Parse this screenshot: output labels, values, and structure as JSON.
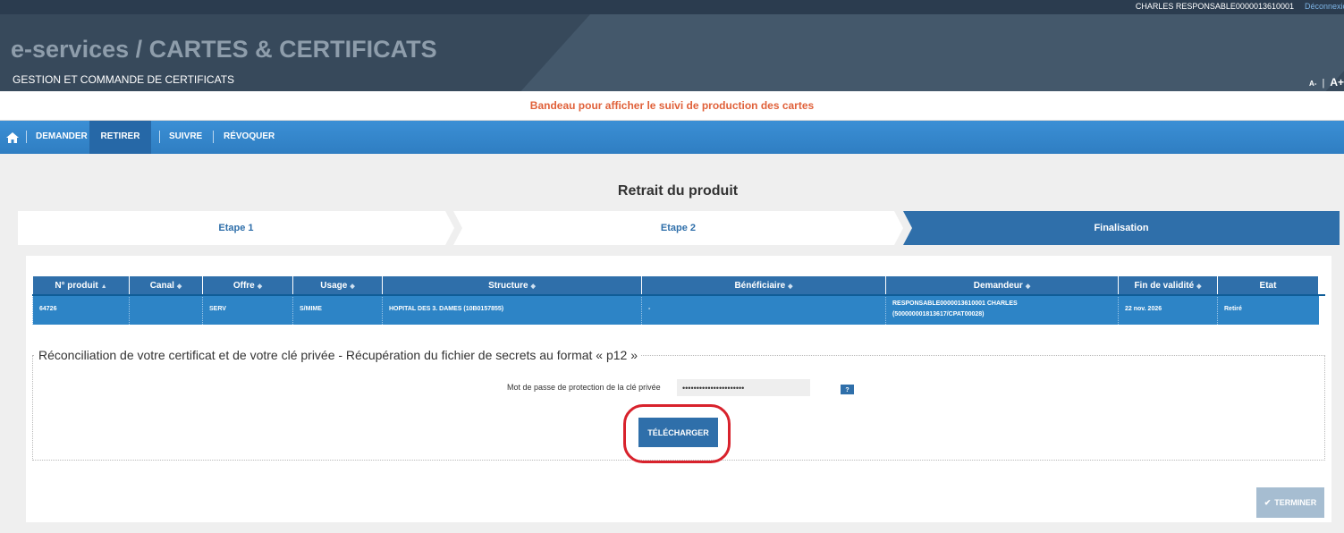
{
  "header": {
    "user_name": "CHARLES RESPONSABLE0000013610001",
    "logout_label": "Déconnexion",
    "app_title": "e-services / CARTES & CERTIFICATS",
    "app_subtitle": "GESTION ET COMMANDE DE CERTIFICATS",
    "font_decrease": "A-",
    "font_separator": "|",
    "font_increase": "A+"
  },
  "notice": "Bandeau pour afficher le suivi de production des cartes",
  "nav": {
    "home_icon": "home-icon",
    "items": [
      {
        "label": "DEMANDER",
        "active": false
      },
      {
        "label": "RETIRER",
        "active": true
      },
      {
        "label": "SUIVRE",
        "active": false
      },
      {
        "label": "RÉVOQUER",
        "active": false
      }
    ]
  },
  "page_title": "Retrait du produit",
  "steps": [
    {
      "label": "Etape 1",
      "active": false
    },
    {
      "label": "Etape 2",
      "active": false
    },
    {
      "label": "Finalisation",
      "active": true
    }
  ],
  "table": {
    "columns": [
      {
        "label": "N° produit",
        "sort": "▲"
      },
      {
        "label": "Canal",
        "sort": "◆"
      },
      {
        "label": "Offre",
        "sort": "◆"
      },
      {
        "label": "Usage",
        "sort": "◆"
      },
      {
        "label": "Structure",
        "sort": "◆"
      },
      {
        "label": "Bénéficiaire",
        "sort": "◆"
      },
      {
        "label": "Demandeur",
        "sort": "◆"
      },
      {
        "label": "Fin de validité",
        "sort": "◆"
      },
      {
        "label": "Etat",
        "sort": ""
      }
    ],
    "rows": [
      {
        "n_produit": "64726",
        "canal": "",
        "offre": "SERV",
        "usage": "S/MIME",
        "structure": "HOPITAL DES 3. DAMES (10B0157855)",
        "beneficiaire": "-",
        "demandeur_line1": "RESPONSABLE0000013610001 CHARLES",
        "demandeur_line2": "(500000001813617/CPAT00028)",
        "fin_validite": "22 nov. 2026",
        "etat": "Retiré"
      }
    ]
  },
  "reconciliation": {
    "legend": "Réconciliation de votre certificat et de votre clé privée - Récupération du fichier de secrets au format « p12 »",
    "password_label": "Mot de passe de protection de la clé privée",
    "password_value": "••••••••••••••••••••••",
    "help_label": "?",
    "download_label": "TÉLÉCHARGER"
  },
  "finish_label": "TERMINER",
  "colors": {
    "nav_blue": "#3b8fd5",
    "active_blue": "#2668a7",
    "table_header": "#2f6faa",
    "row_selected": "#2d84c6",
    "notice_orange": "#e0613a",
    "highlight_red": "#d8222c"
  }
}
